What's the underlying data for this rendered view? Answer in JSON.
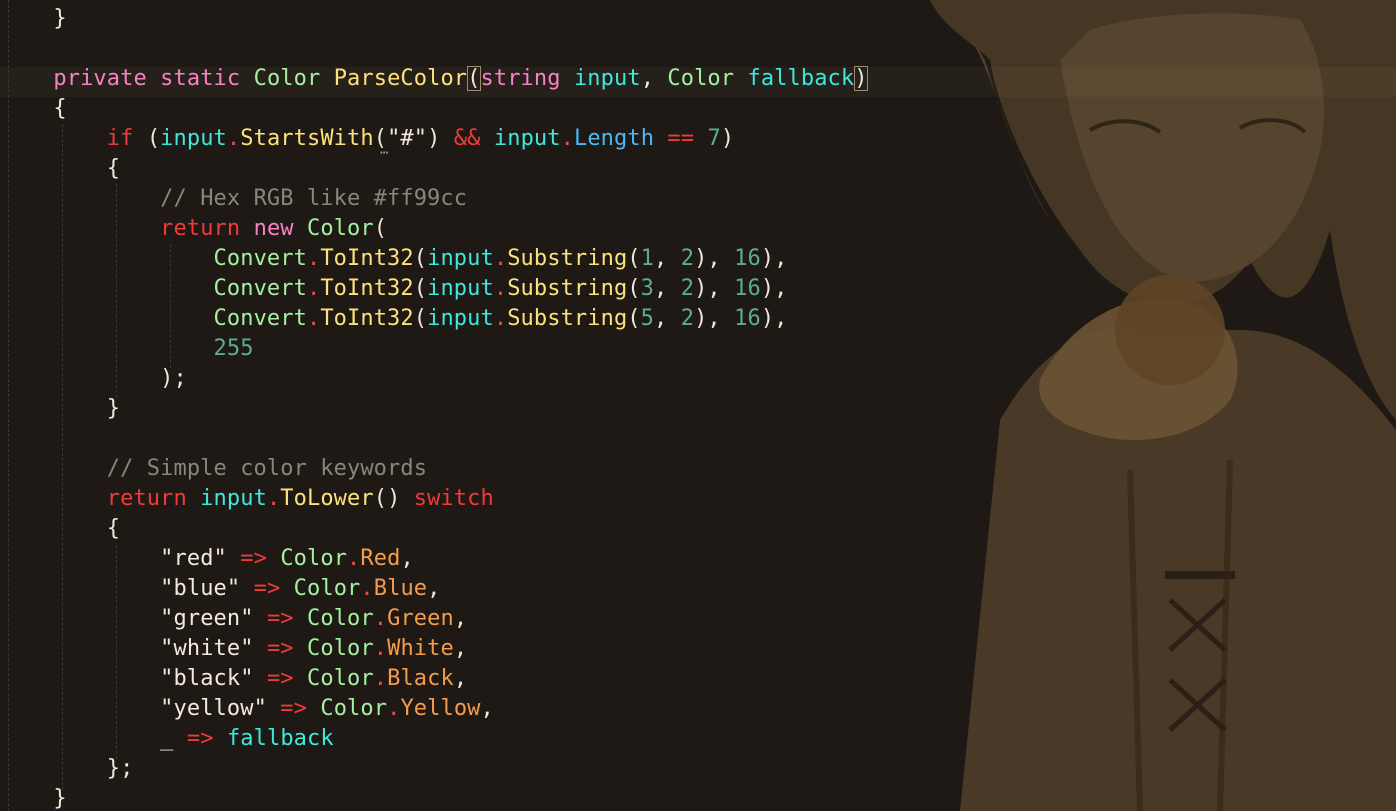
{
  "editor": {
    "language": "csharp",
    "colors": {
      "background": "#1e1914",
      "keyword": "#f781c4",
      "type": "#a4f0a0",
      "method": "#fde27a",
      "parameter": "#3de8dc",
      "property": "#4ab8f5",
      "control": "#f03a3a",
      "number": "#5aae8f",
      "comment": "#8a857b",
      "enum_member": "#f59c4a"
    },
    "background_art": "anime-character-illustration",
    "lines": [
      [
        {
          "t": "    }",
          "c": "plain"
        }
      ],
      [
        {
          "t": "",
          "c": "plain"
        }
      ],
      [
        {
          "t": "    ",
          "c": "plain"
        },
        {
          "t": "private",
          "c": "keyword"
        },
        {
          "t": " ",
          "c": "plain"
        },
        {
          "t": "static",
          "c": "keyword"
        },
        {
          "t": " ",
          "c": "plain"
        },
        {
          "t": "Color",
          "c": "type"
        },
        {
          "t": " ",
          "c": "plain"
        },
        {
          "t": "ParseColor",
          "c": "method"
        },
        {
          "t": "(",
          "c": "punct",
          "hl": true
        },
        {
          "t": "string",
          "c": "keyword"
        },
        {
          "t": " ",
          "c": "plain"
        },
        {
          "t": "input",
          "c": "param"
        },
        {
          "t": ", ",
          "c": "punct"
        },
        {
          "t": "Color",
          "c": "type"
        },
        {
          "t": " ",
          "c": "plain"
        },
        {
          "t": "fallback",
          "c": "param"
        },
        {
          "t": ")",
          "c": "punct",
          "hl": true
        }
      ],
      [
        {
          "t": "    {",
          "c": "plain"
        }
      ],
      [
        {
          "t": "        ",
          "c": "plain"
        },
        {
          "t": "if",
          "c": "control"
        },
        {
          "t": " (",
          "c": "punct"
        },
        {
          "t": "input",
          "c": "param"
        },
        {
          "t": ".",
          "c": "dot"
        },
        {
          "t": "StartsWith",
          "c": "method"
        },
        {
          "t": "(",
          "c": "punct"
        },
        {
          "t": "\"#\"",
          "c": "string"
        },
        {
          "t": ") ",
          "c": "punct"
        },
        {
          "t": "&&",
          "c": "control"
        },
        {
          "t": " ",
          "c": "plain"
        },
        {
          "t": "input",
          "c": "param"
        },
        {
          "t": ".",
          "c": "dot"
        },
        {
          "t": "Length",
          "c": "property"
        },
        {
          "t": " ",
          "c": "plain"
        },
        {
          "t": "==",
          "c": "control"
        },
        {
          "t": " ",
          "c": "plain"
        },
        {
          "t": "7",
          "c": "number"
        },
        {
          "t": ")",
          "c": "punct"
        }
      ],
      [
        {
          "t": "        {",
          "c": "plain"
        }
      ],
      [
        {
          "t": "            ",
          "c": "plain"
        },
        {
          "t": "// Hex RGB like #ff99cc",
          "c": "comment"
        }
      ],
      [
        {
          "t": "            ",
          "c": "plain"
        },
        {
          "t": "return",
          "c": "control"
        },
        {
          "t": " ",
          "c": "plain"
        },
        {
          "t": "new",
          "c": "keyword"
        },
        {
          "t": " ",
          "c": "plain"
        },
        {
          "t": "Color",
          "c": "type"
        },
        {
          "t": "(",
          "c": "punct"
        }
      ],
      [
        {
          "t": "                ",
          "c": "plain"
        },
        {
          "t": "Convert",
          "c": "type"
        },
        {
          "t": ".",
          "c": "dot"
        },
        {
          "t": "ToInt32",
          "c": "method"
        },
        {
          "t": "(",
          "c": "punct"
        },
        {
          "t": "input",
          "c": "param"
        },
        {
          "t": ".",
          "c": "dot"
        },
        {
          "t": "Substring",
          "c": "method"
        },
        {
          "t": "(",
          "c": "punct"
        },
        {
          "t": "1",
          "c": "number"
        },
        {
          "t": ", ",
          "c": "punct"
        },
        {
          "t": "2",
          "c": "number"
        },
        {
          "t": "), ",
          "c": "punct"
        },
        {
          "t": "16",
          "c": "number"
        },
        {
          "t": "),",
          "c": "punct"
        }
      ],
      [
        {
          "t": "                ",
          "c": "plain"
        },
        {
          "t": "Convert",
          "c": "type"
        },
        {
          "t": ".",
          "c": "dot"
        },
        {
          "t": "ToInt32",
          "c": "method"
        },
        {
          "t": "(",
          "c": "punct"
        },
        {
          "t": "input",
          "c": "param"
        },
        {
          "t": ".",
          "c": "dot"
        },
        {
          "t": "Substring",
          "c": "method"
        },
        {
          "t": "(",
          "c": "punct"
        },
        {
          "t": "3",
          "c": "number"
        },
        {
          "t": ", ",
          "c": "punct"
        },
        {
          "t": "2",
          "c": "number"
        },
        {
          "t": "), ",
          "c": "punct"
        },
        {
          "t": "16",
          "c": "number"
        },
        {
          "t": "),",
          "c": "punct"
        }
      ],
      [
        {
          "t": "                ",
          "c": "plain"
        },
        {
          "t": "Convert",
          "c": "type"
        },
        {
          "t": ".",
          "c": "dot"
        },
        {
          "t": "ToInt32",
          "c": "method"
        },
        {
          "t": "(",
          "c": "punct"
        },
        {
          "t": "input",
          "c": "param"
        },
        {
          "t": ".",
          "c": "dot"
        },
        {
          "t": "Substring",
          "c": "method"
        },
        {
          "t": "(",
          "c": "punct"
        },
        {
          "t": "5",
          "c": "number"
        },
        {
          "t": ", ",
          "c": "punct"
        },
        {
          "t": "2",
          "c": "number"
        },
        {
          "t": "), ",
          "c": "punct"
        },
        {
          "t": "16",
          "c": "number"
        },
        {
          "t": "),",
          "c": "punct"
        }
      ],
      [
        {
          "t": "                ",
          "c": "plain"
        },
        {
          "t": "255",
          "c": "number"
        }
      ],
      [
        {
          "t": "            );",
          "c": "plain"
        }
      ],
      [
        {
          "t": "        }",
          "c": "plain"
        }
      ],
      [
        {
          "t": "",
          "c": "plain"
        }
      ],
      [
        {
          "t": "        ",
          "c": "plain"
        },
        {
          "t": "// Simple color keywords",
          "c": "comment"
        }
      ],
      [
        {
          "t": "        ",
          "c": "plain"
        },
        {
          "t": "return",
          "c": "control"
        },
        {
          "t": " ",
          "c": "plain"
        },
        {
          "t": "input",
          "c": "param"
        },
        {
          "t": ".",
          "c": "dot"
        },
        {
          "t": "ToLower",
          "c": "method"
        },
        {
          "t": "() ",
          "c": "punct"
        },
        {
          "t": "switch",
          "c": "control"
        }
      ],
      [
        {
          "t": "        {",
          "c": "plain"
        }
      ],
      [
        {
          "t": "            ",
          "c": "plain"
        },
        {
          "t": "\"red\"",
          "c": "string"
        },
        {
          "t": " ",
          "c": "plain"
        },
        {
          "t": "=>",
          "c": "control"
        },
        {
          "t": " ",
          "c": "plain"
        },
        {
          "t": "Color",
          "c": "type"
        },
        {
          "t": ".",
          "c": "dot"
        },
        {
          "t": "Red",
          "c": "enum"
        },
        {
          "t": ",",
          "c": "punct"
        }
      ],
      [
        {
          "t": "            ",
          "c": "plain"
        },
        {
          "t": "\"blue\"",
          "c": "string"
        },
        {
          "t": " ",
          "c": "plain"
        },
        {
          "t": "=>",
          "c": "control"
        },
        {
          "t": " ",
          "c": "plain"
        },
        {
          "t": "Color",
          "c": "type"
        },
        {
          "t": ".",
          "c": "dot"
        },
        {
          "t": "Blue",
          "c": "enum"
        },
        {
          "t": ",",
          "c": "punct"
        }
      ],
      [
        {
          "t": "            ",
          "c": "plain"
        },
        {
          "t": "\"green\"",
          "c": "string"
        },
        {
          "t": " ",
          "c": "plain"
        },
        {
          "t": "=>",
          "c": "control"
        },
        {
          "t": " ",
          "c": "plain"
        },
        {
          "t": "Color",
          "c": "type"
        },
        {
          "t": ".",
          "c": "dot"
        },
        {
          "t": "Green",
          "c": "enum"
        },
        {
          "t": ",",
          "c": "punct"
        }
      ],
      [
        {
          "t": "            ",
          "c": "plain"
        },
        {
          "t": "\"white\"",
          "c": "string"
        },
        {
          "t": " ",
          "c": "plain"
        },
        {
          "t": "=>",
          "c": "control"
        },
        {
          "t": " ",
          "c": "plain"
        },
        {
          "t": "Color",
          "c": "type"
        },
        {
          "t": ".",
          "c": "dot"
        },
        {
          "t": "White",
          "c": "enum"
        },
        {
          "t": ",",
          "c": "punct"
        }
      ],
      [
        {
          "t": "            ",
          "c": "plain"
        },
        {
          "t": "\"black\"",
          "c": "string"
        },
        {
          "t": " ",
          "c": "plain"
        },
        {
          "t": "=>",
          "c": "control"
        },
        {
          "t": " ",
          "c": "plain"
        },
        {
          "t": "Color",
          "c": "type"
        },
        {
          "t": ".",
          "c": "dot"
        },
        {
          "t": "Black",
          "c": "enum"
        },
        {
          "t": ",",
          "c": "punct"
        }
      ],
      [
        {
          "t": "            ",
          "c": "plain"
        },
        {
          "t": "\"yellow\"",
          "c": "string"
        },
        {
          "t": " ",
          "c": "plain"
        },
        {
          "t": "=>",
          "c": "control"
        },
        {
          "t": " ",
          "c": "plain"
        },
        {
          "t": "Color",
          "c": "type"
        },
        {
          "t": ".",
          "c": "dot"
        },
        {
          "t": "Yellow",
          "c": "enum"
        },
        {
          "t": ",",
          "c": "punct"
        }
      ],
      [
        {
          "t": "            ",
          "c": "plain"
        },
        {
          "t": "_",
          "c": "plain"
        },
        {
          "t": " ",
          "c": "plain"
        },
        {
          "t": "=>",
          "c": "control"
        },
        {
          "t": " ",
          "c": "plain"
        },
        {
          "t": "fallback",
          "c": "param"
        }
      ],
      [
        {
          "t": "        };",
          "c": "plain"
        }
      ],
      [
        {
          "t": "    }",
          "c": "plain"
        }
      ]
    ]
  }
}
